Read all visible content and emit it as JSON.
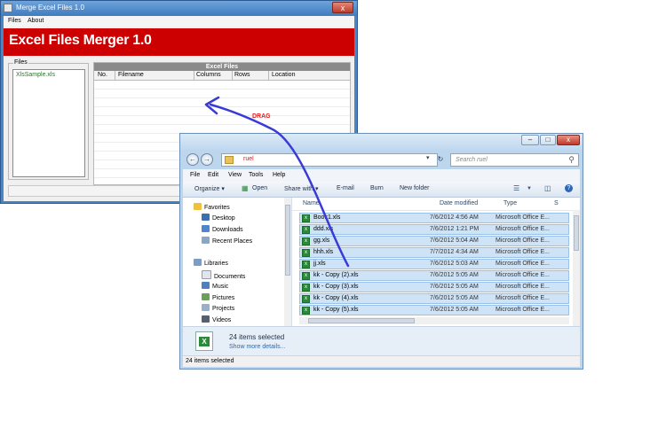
{
  "merge_window": {
    "title": "Merge Excel Files 1.0",
    "close_glyph": "x",
    "menu": [
      "Files",
      "About"
    ],
    "banner_title": "Excel Files Merger 1.0",
    "files_group_label": "Files",
    "files": [
      "XlsSample.xls"
    ],
    "excel_files_header": "Excel Files",
    "columns": [
      "No.",
      "Filename",
      "Columns",
      "Rows",
      "Location"
    ]
  },
  "annotation": {
    "drag_label": "DRAG"
  },
  "explorer": {
    "window_buttons": [
      "–",
      "□",
      "x"
    ],
    "address_text": "ruel",
    "search_placeholder": "Search ruel",
    "menu": [
      "File",
      "Edit",
      "View",
      "Tools",
      "Help"
    ],
    "toolbar": {
      "organize": "Organize ▾",
      "open": "Open",
      "share_with": "Share with ▾",
      "email": "E-mail",
      "burn": "Burn",
      "new_folder": "New folder"
    },
    "nav": {
      "favorites_label": "Favorites",
      "favorites": [
        "Desktop",
        "Downloads",
        "Recent Places"
      ],
      "libraries_label": "Libraries",
      "libraries": [
        "Documents",
        "Music",
        "Pictures",
        "Projects",
        "Videos"
      ]
    },
    "columns": [
      "Name",
      "Date modified",
      "Type",
      "S"
    ],
    "rows": [
      {
        "name": "Book1.xls",
        "date": "7/6/2012 4:56 AM",
        "type": "Microsoft Office E..."
      },
      {
        "name": "ddd.xls",
        "date": "7/6/2012 1:21 PM",
        "type": "Microsoft Office E..."
      },
      {
        "name": "gg.xls",
        "date": "7/6/2012 5:04 AM",
        "type": "Microsoft Office E..."
      },
      {
        "name": "hhh.xls",
        "date": "7/7/2012 4:34 AM",
        "type": "Microsoft Office E..."
      },
      {
        "name": "jj.xls",
        "date": "7/6/2012 5:03 AM",
        "type": "Microsoft Office E..."
      },
      {
        "name": "kk - Copy (2).xls",
        "date": "7/6/2012 5:05 AM",
        "type": "Microsoft Office E..."
      },
      {
        "name": "kk - Copy (3).xls",
        "date": "7/6/2012 5:05 AM",
        "type": "Microsoft Office E..."
      },
      {
        "name": "kk - Copy (4).xls",
        "date": "7/6/2012 5:05 AM",
        "type": "Microsoft Office E..."
      },
      {
        "name": "kk - Copy (5).xls",
        "date": "7/6/2012 5:05 AM",
        "type": "Microsoft Office E..."
      }
    ],
    "details_count": "24 items selected",
    "details_more": "Show more details...",
    "status_text": "24 items selected"
  },
  "colors": {
    "banner": "#cc0000",
    "selection": "#cfe3f7",
    "drag_arrow": "#3a3ad6",
    "drag_label": "#e31c1c"
  }
}
